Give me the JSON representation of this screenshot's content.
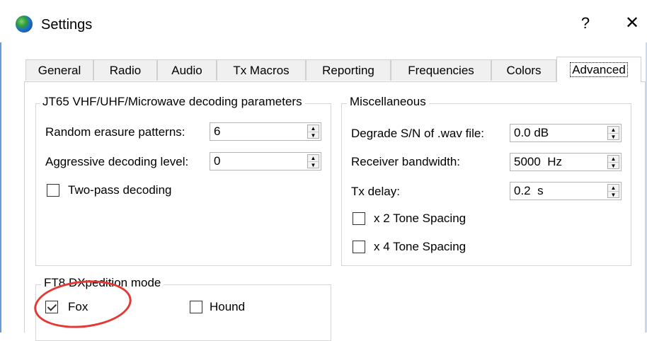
{
  "window": {
    "title": "Settings",
    "help_label": "?",
    "close_label": "✕"
  },
  "tabs": [
    {
      "label": "General"
    },
    {
      "label": "Radio"
    },
    {
      "label": "Audio"
    },
    {
      "label": "Tx Macros"
    },
    {
      "label": "Reporting"
    },
    {
      "label": "Frequencies"
    },
    {
      "label": "Colors"
    },
    {
      "label": "Advanced"
    }
  ],
  "active_tab": "Advanced",
  "jt65": {
    "title": "JT65 VHF/UHF/Microwave decoding parameters",
    "erasure_label": "Random erasure patterns:",
    "erasure_value": "6",
    "aggressive_label": "Aggressive decoding level:",
    "aggressive_value": "0",
    "two_pass_label": "Two-pass decoding",
    "two_pass_checked": false
  },
  "misc": {
    "title": "Miscellaneous",
    "degrade_label": "Degrade S/N of .wav file:",
    "degrade_value": "0.0 dB",
    "bandwidth_label": "Receiver bandwidth:",
    "bandwidth_value": "5000  Hz",
    "txdelay_label": "Tx delay:",
    "txdelay_value": "0.2  s",
    "x2_label": "x 2 Tone Spacing",
    "x2_checked": false,
    "x4_label": "x 4 Tone Spacing",
    "x4_checked": false
  },
  "ft8": {
    "title": "FT8 DXpedition mode",
    "fox_label": "Fox",
    "fox_checked": true,
    "hound_label": "Hound",
    "hound_checked": false
  },
  "annotation_color": "#e53935"
}
